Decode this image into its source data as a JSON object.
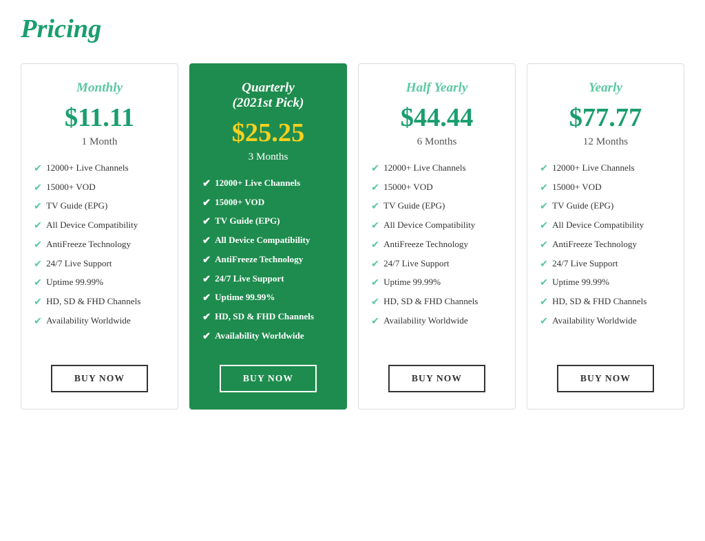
{
  "page": {
    "title": "Pricing"
  },
  "plans": [
    {
      "id": "monthly",
      "name": "Monthly",
      "featured": false,
      "price": "$11.11",
      "duration": "1 Month",
      "features": [
        "12000+ Live Channels",
        "15000+ VOD",
        "TV Guide (EPG)",
        "All Device Compatibility",
        "AntiFreeze Technology",
        "24/7 Live Support",
        "Uptime 99.99%",
        "HD, SD & FHD Channels",
        "Availability Worldwide"
      ],
      "button_label": "BUY NOW"
    },
    {
      "id": "quarterly",
      "name": "Quarterly\n(2021st Pick)",
      "featured": true,
      "price": "$25.25",
      "duration": "3 Months",
      "features": [
        "12000+ Live Channels",
        "15000+ VOD",
        "TV Guide (EPG)",
        "All Device Compatibility",
        "AntiFreeze Technology",
        "24/7 Live Support",
        "Uptime 99.99%",
        "HD, SD & FHD Channels",
        "Availability Worldwide"
      ],
      "button_label": "BUY NOW"
    },
    {
      "id": "half-yearly",
      "name": "Half Yearly",
      "featured": false,
      "price": "$44.44",
      "duration": "6 Months",
      "features": [
        "12000+ Live Channels",
        "15000+ VOD",
        "TV Guide (EPG)",
        "All Device Compatibility",
        "AntiFreeze Technology",
        "24/7 Live Support",
        "Uptime 99.99%",
        "HD, SD & FHD Channels",
        "Availability Worldwide"
      ],
      "button_label": "BUY NOW"
    },
    {
      "id": "yearly",
      "name": "Yearly",
      "featured": false,
      "price": "$77.77",
      "duration": "12 Months",
      "features": [
        "12000+ Live Channels",
        "15000+ VOD",
        "TV Guide (EPG)",
        "All Device Compatibility",
        "AntiFreeze Technology",
        "24/7 Live Support",
        "Uptime 99.99%",
        "HD, SD & FHD Channels",
        "Availability Worldwide"
      ],
      "button_label": "BUY NOW"
    }
  ]
}
